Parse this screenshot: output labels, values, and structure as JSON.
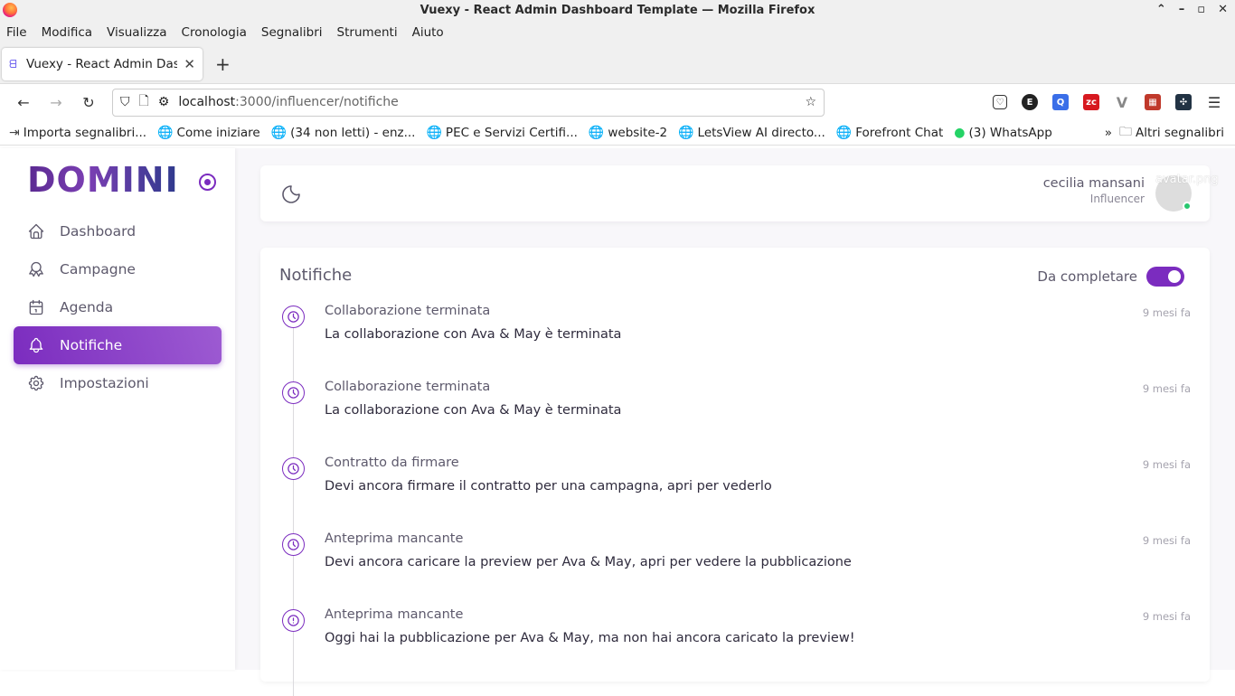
{
  "window": {
    "title": "Vuexy - React Admin Dashboard Template — Mozilla Firefox"
  },
  "menubar": [
    "File",
    "Modifica",
    "Visualizza",
    "Cronologia",
    "Segnalibri",
    "Strumenti",
    "Aiuto"
  ],
  "tab": {
    "title": "Vuexy - React Admin Das",
    "new_tab": "+"
  },
  "url": {
    "host": "localhost",
    "rest": ":3000/influencer/notifiche"
  },
  "bookmarks": [
    {
      "label": "Importa segnalibri...",
      "icon": "import-icon"
    },
    {
      "label": "Come iniziare",
      "icon": "globe-icon"
    },
    {
      "label": "(34 non letti) - enz...",
      "icon": "globe-icon"
    },
    {
      "label": "PEC e Servizi Certifi...",
      "icon": "globe-icon"
    },
    {
      "label": "website-2",
      "icon": "globe-icon"
    },
    {
      "label": "LetsView AI directo...",
      "icon": "globe-icon"
    },
    {
      "label": "Forefront Chat",
      "icon": "globe-icon"
    },
    {
      "label": "(3) WhatsApp",
      "icon": "whatsapp-icon"
    }
  ],
  "bookmarks_other": "Altri segnalibri",
  "brand": {
    "logo": "DOMINI",
    "accent": "#7b2cbf"
  },
  "sidebar": {
    "items": [
      {
        "label": "Dashboard",
        "icon": "home-icon"
      },
      {
        "label": "Campagne",
        "icon": "award-icon"
      },
      {
        "label": "Agenda",
        "icon": "calendar-icon"
      },
      {
        "label": "Notifiche",
        "icon": "bell-icon",
        "active": true
      },
      {
        "label": "Impostazioni",
        "icon": "settings-icon"
      }
    ]
  },
  "user": {
    "name": "cecilia mansani",
    "role": "Influencer",
    "avatar_alt": "avatar.png"
  },
  "notifications": {
    "title": "Notifiche",
    "filter_label": "Da completare",
    "filter_on": true,
    "items": [
      {
        "title": "Collaborazione terminata",
        "time": "9 mesi fa",
        "body": "La collaborazione con Ava & May è terminata",
        "icon": "clock-icon"
      },
      {
        "title": "Collaborazione terminata",
        "time": "9 mesi fa",
        "body": "La collaborazione con Ava & May è terminata",
        "icon": "clock-icon"
      },
      {
        "title": "Contratto da firmare",
        "time": "9 mesi fa",
        "body": "Devi ancora firmare il contratto per una campagna, apri per vederlo",
        "icon": "clock-icon"
      },
      {
        "title": "Anteprima mancante",
        "time": "9 mesi fa",
        "body": "Devi ancora caricare la preview per Ava & May, apri per vedere la pubblicazione",
        "icon": "clock-icon"
      },
      {
        "title": "Anteprima mancante",
        "time": "9 mesi fa",
        "body": "Oggi hai la pubblicazione per Ava & May, ma non hai ancora caricato la preview!",
        "icon": "alert-circle-icon"
      }
    ]
  }
}
